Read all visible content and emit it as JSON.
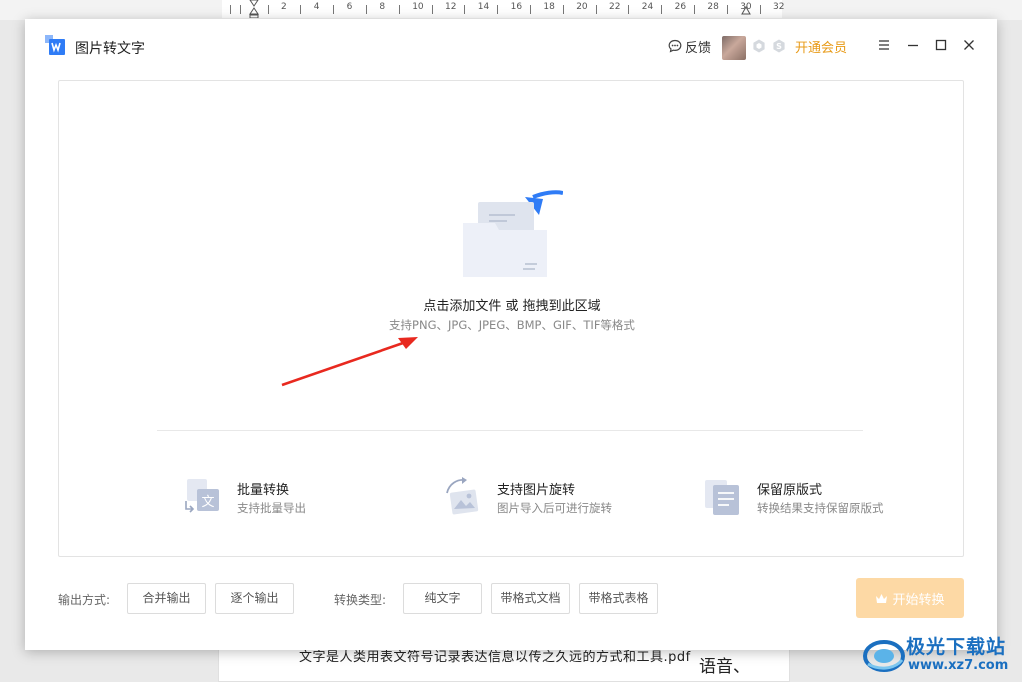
{
  "ruler": {
    "numbers": [
      "2",
      "4",
      "6",
      "8",
      "10",
      "12",
      "14",
      "16",
      "18",
      "20",
      "22",
      "24",
      "26",
      "28",
      "30",
      "32"
    ]
  },
  "background_doc": {
    "line1": "文字是人类用表文符号记录表达信息以传之久远的方式和工具.pdf",
    "line2": "语音、"
  },
  "app": {
    "title": "图片转文字",
    "feedback_label": "反馈",
    "vip_label": "开通会员",
    "accent_color": "#e89a17",
    "brand_color": "#2f7cf6"
  },
  "drop_area": {
    "title": "点击添加文件 或 拖拽到此区域",
    "subtitle": "支持PNG、JPG、JPEG、BMP、GIF、TIF等格式"
  },
  "features": [
    {
      "title": "批量转换",
      "desc": "支持批量导出",
      "icon": "batch-convert-icon"
    },
    {
      "title": "支持图片旋转",
      "desc": "图片导入后可进行旋转",
      "icon": "image-rotate-icon"
    },
    {
      "title": "保留原版式",
      "desc": "转换结果支持保留原版式",
      "icon": "keep-layout-icon"
    }
  ],
  "options": {
    "output_label": "输出方式:",
    "output_merge": "合并输出",
    "output_each": "逐个输出",
    "type_label": "转换类型:",
    "type_plain": "纯文字",
    "type_doc": "带格式文档",
    "type_table": "带格式表格",
    "start_label": "开始转换",
    "start_color": "#fdd9a5"
  },
  "watermark": {
    "name": "极光下载站",
    "url": "www.xz7.com"
  }
}
